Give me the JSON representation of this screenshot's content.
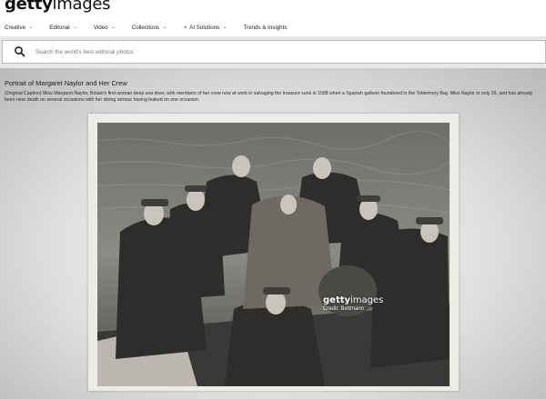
{
  "brand": {
    "logo_bold": "getty",
    "logo_light": "images"
  },
  "nav": {
    "items": [
      {
        "label": "Creative",
        "chevron": true
      },
      {
        "label": "Editorial",
        "chevron": true
      },
      {
        "label": "Video",
        "chevron": true
      },
      {
        "label": "Collections",
        "chevron": true
      },
      {
        "label": "AI Solutions",
        "chevron": true,
        "icon": "sparkle-icon"
      },
      {
        "label": "Trends & Insights",
        "chevron": false
      }
    ]
  },
  "search": {
    "placeholder": "Search the world's best editorial photos",
    "icon": "search-icon"
  },
  "asset": {
    "title": "Portrait of Margaret Naylor and Her Crew",
    "caption": "(Original Caption) Miss Margaret Naylor, Britain's first woman deep sea diver, with members of her crew now at work in salvaging the treasure sunk in 1588 when a Spanish galleon foundered in the Tobermory Bay. Miss Naylor in only 26, and has already been near death on several occasions with her diving armour having leaked on one occasion.",
    "watermark_bold": "getty",
    "watermark_light": "images",
    "credit": "Credit: Bettmann",
    "image_id": "515963450"
  },
  "colors": {
    "search_band": "#e7e7e7",
    "text": "#1a1a1a",
    "placeholder": "#7a7a7a"
  }
}
